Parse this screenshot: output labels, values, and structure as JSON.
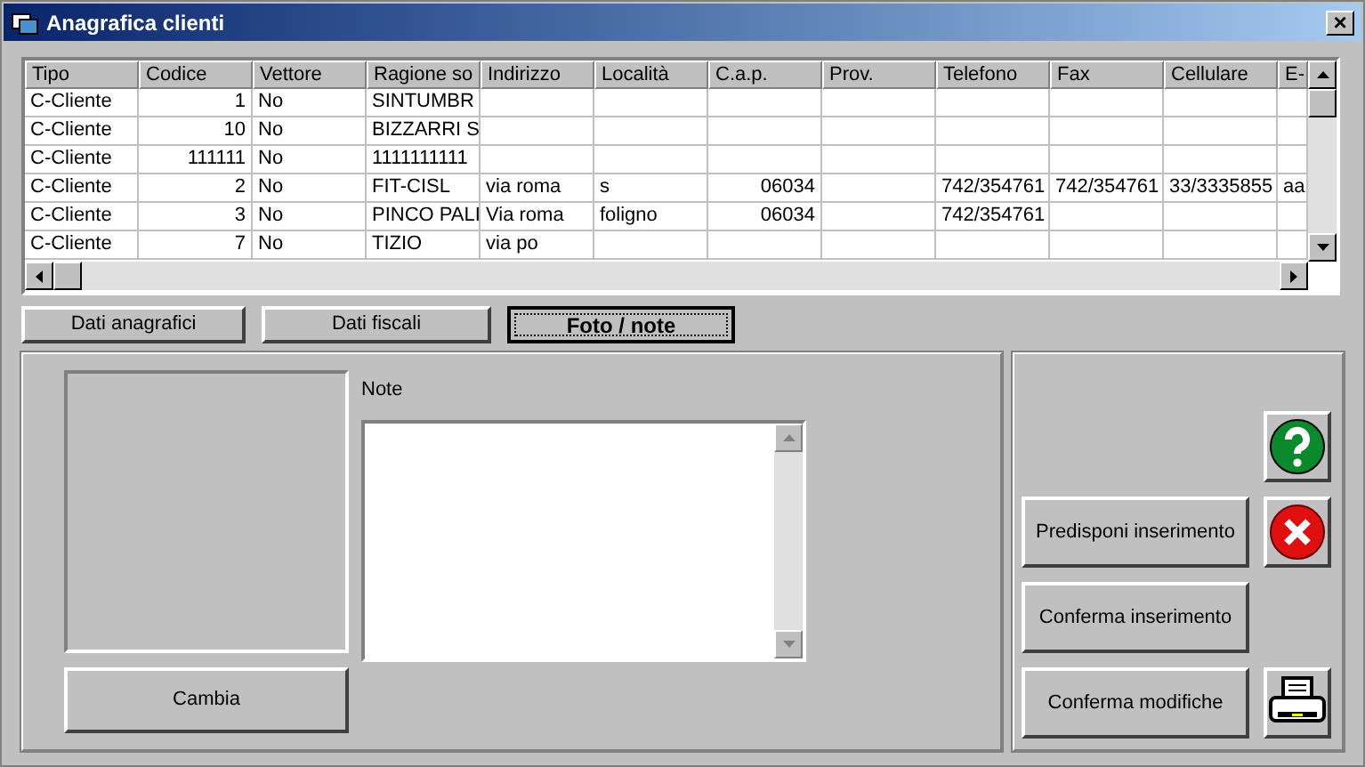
{
  "window": {
    "title": "Anagrafica clienti",
    "close": "×"
  },
  "table": {
    "columns": [
      "Tipo",
      "Codice",
      "Vettore",
      "Ragione so",
      "Indirizzo",
      "Località",
      "C.a.p.",
      "Prov.",
      "Telefono",
      "Fax",
      "Cellulare",
      "E-"
    ],
    "rows": [
      [
        "C-Cliente",
        "1",
        "No",
        "SINTUMBR",
        "",
        "",
        "",
        "",
        "",
        "",
        "",
        ""
      ],
      [
        "C-Cliente",
        "10",
        "No",
        "BIZZARRI S",
        "",
        "",
        "",
        "",
        "",
        "",
        "",
        ""
      ],
      [
        "C-Cliente",
        "111111",
        "No",
        "1111111111",
        "",
        "",
        "",
        "",
        "",
        "",
        "",
        ""
      ],
      [
        "C-Cliente",
        "2",
        "No",
        "FIT-CISL",
        "via roma",
        "s",
        "06034",
        "",
        "742/354761",
        "742/354761",
        "33/3335855",
        "aa"
      ],
      [
        "C-Cliente",
        "3",
        "No",
        "PINCO PALI",
        "Via roma",
        "foligno",
        "06034",
        "",
        "742/354761",
        "",
        "",
        ""
      ],
      [
        "C-Cliente",
        "7",
        "No",
        "TIZIO",
        "via po",
        "",
        "",
        "",
        "",
        "",
        "",
        ""
      ]
    ]
  },
  "tabs": [
    {
      "label": "Dati anagrafici",
      "selected": false
    },
    {
      "label": "Dati fiscali",
      "selected": false
    },
    {
      "label": "Foto / note",
      "selected": true
    }
  ],
  "notes": {
    "label": "Note",
    "change_button": "Cambia"
  },
  "actions": [
    {
      "kind": "help"
    },
    {
      "kind": "text",
      "label": "Predisponi inserimento"
    },
    {
      "kind": "cancel"
    },
    {
      "kind": "text",
      "label": "Conferma inserimento"
    },
    {
      "kind": "text",
      "label": "Conferma modifiche"
    },
    {
      "kind": "print"
    }
  ]
}
